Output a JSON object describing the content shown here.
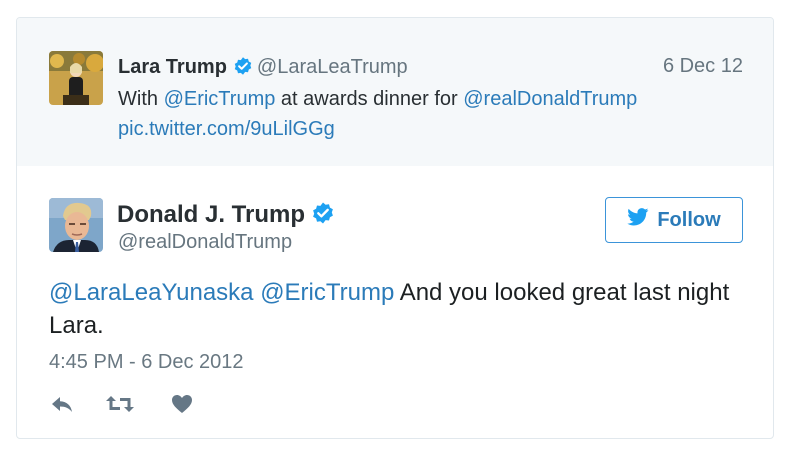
{
  "quoted_tweet": {
    "name": "Lara Trump",
    "handle": "@LaraLeaTrump",
    "date": "6 Dec 12",
    "text_prefix": "With ",
    "mention_1": "@EricTrump",
    "text_middle": " at awards dinner for ",
    "mention_2": "@realDonaldTrump",
    "pic_link": "pic.twitter.com/9uLilGGg",
    "avatar_icon": "profile-photo"
  },
  "tweet": {
    "name": "Donald J. Trump",
    "handle": "@realDonaldTrump",
    "mention_1": "@LaraLeaYunaska",
    "mention_2": "@EricTrump",
    "text_rest": " And you looked great last night Lara.",
    "timestamp": "4:45 PM - 6 Dec 2012",
    "follow_label": "Follow",
    "avatar_icon": "profile-photo"
  },
  "icons": {
    "verified": "verified-badge-icon",
    "bird": "twitter-bird-icon",
    "reply": "reply-icon",
    "retweet": "retweet-icon",
    "like": "heart-icon"
  },
  "colors": {
    "link": "#2b7bb9",
    "verified": "#1da1f2",
    "muted": "#66757f",
    "action_icon": "#657786",
    "quoted_bg": "#f5f8fa"
  }
}
